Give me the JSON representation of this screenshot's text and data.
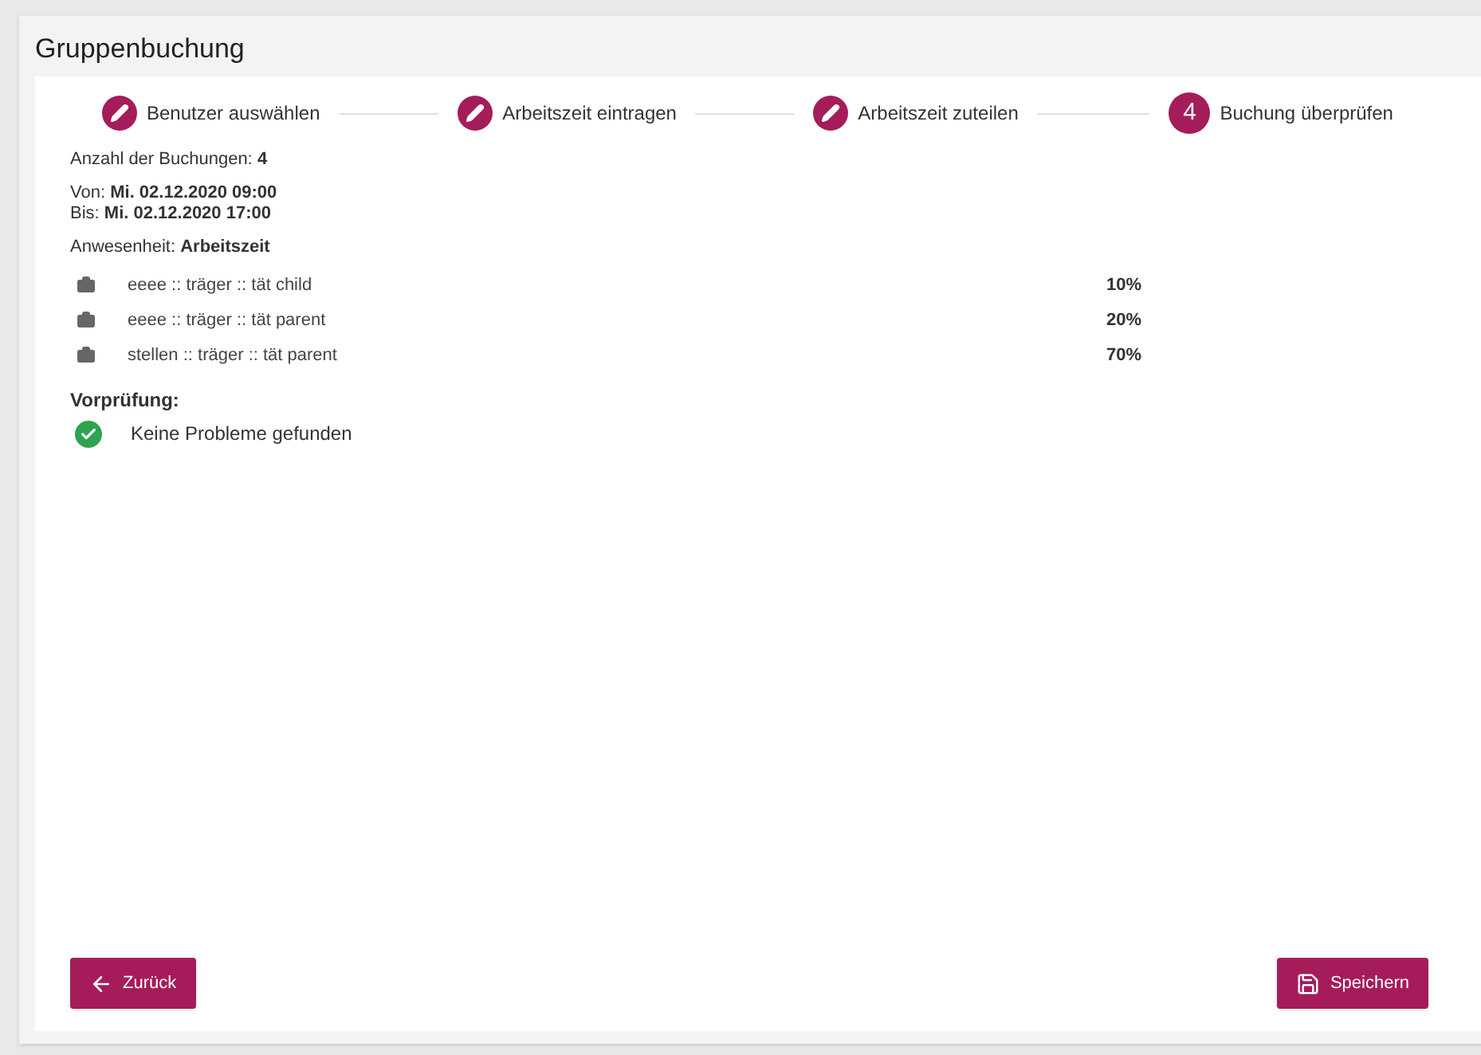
{
  "title": "Gruppenbuchung",
  "steps": [
    {
      "kind": "done",
      "label": "Benutzer auswählen"
    },
    {
      "kind": "done",
      "label": "Arbeitszeit eintragen"
    },
    {
      "kind": "done",
      "label": "Arbeitszeit zuteilen"
    },
    {
      "kind": "current",
      "number": "4",
      "label": "Buchung überprüfen"
    }
  ],
  "count": {
    "label": "Anzahl der Buchungen:",
    "value": "4"
  },
  "from": {
    "label": "Von:",
    "value": "Mi. 02.12.2020 09:00"
  },
  "to": {
    "label": "Bis:",
    "value": "Mi. 02.12.2020 17:00"
  },
  "attendance": {
    "label": "Anwesenheit:",
    "value": "Arbeitszeit"
  },
  "allocations": [
    {
      "name": "eeee :: träger :: tät child",
      "share": "10%"
    },
    {
      "name": "eeee :: träger :: tät parent",
      "share": "20%"
    },
    {
      "name": "stellen :: träger :: tät parent",
      "share": "70%"
    }
  ],
  "precheck": {
    "heading": "Vorprüfung:",
    "kind": "ok",
    "message": "Keine Probleme gefunden"
  },
  "buttons": {
    "back": "Zurück",
    "save": "Speichern"
  }
}
